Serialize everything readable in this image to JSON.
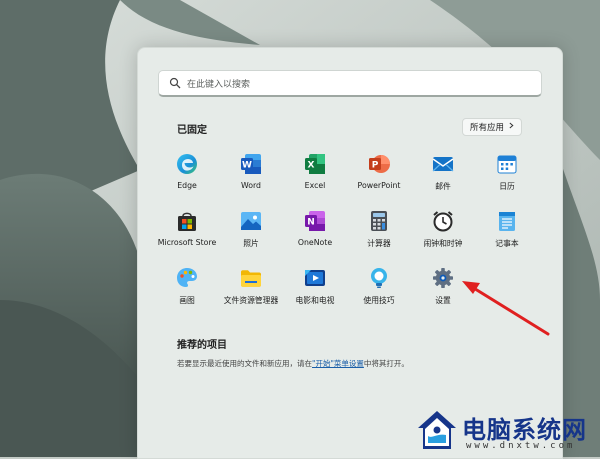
{
  "search": {
    "placeholder": "在此键入以搜索",
    "icon": "search-icon"
  },
  "pinned": {
    "title": "已固定",
    "all_apps": "所有应用",
    "apps": [
      {
        "label": "Edge",
        "icon": "edge-icon"
      },
      {
        "label": "Word",
        "icon": "word-icon"
      },
      {
        "label": "Excel",
        "icon": "excel-icon"
      },
      {
        "label": "PowerPoint",
        "icon": "powerpoint-icon"
      },
      {
        "label": "邮件",
        "icon": "mail-icon"
      },
      {
        "label": "日历",
        "icon": "calendar-icon"
      },
      {
        "label": "Microsoft Store",
        "icon": "store-icon"
      },
      {
        "label": "照片",
        "icon": "photos-icon"
      },
      {
        "label": "OneNote",
        "icon": "onenote-icon"
      },
      {
        "label": "计算器",
        "icon": "calculator-icon"
      },
      {
        "label": "闹钟和时钟",
        "icon": "alarm-clock-icon"
      },
      {
        "label": "记事本",
        "icon": "notepad-icon"
      },
      {
        "label": "画图",
        "icon": "paint-icon"
      },
      {
        "label": "文件资源管理器",
        "icon": "folder-icon"
      },
      {
        "label": "电影和电视",
        "icon": "movies-icon"
      },
      {
        "label": "使用技巧",
        "icon": "tips-icon"
      },
      {
        "label": "设置",
        "icon": "settings-gear-icon"
      }
    ]
  },
  "recommended": {
    "title": "推荐的项目",
    "text_before": "若要显示最近使用的文件和新应用，请在",
    "link": "\"开始\"菜单设置",
    "text_after": "中将其打开。"
  },
  "watermark": {
    "title": "电脑系统网",
    "url": "www.dnxtw.com"
  },
  "colors": {
    "accent": "#0067c0",
    "arrow": "#e02020",
    "watermark": "#16358a"
  }
}
